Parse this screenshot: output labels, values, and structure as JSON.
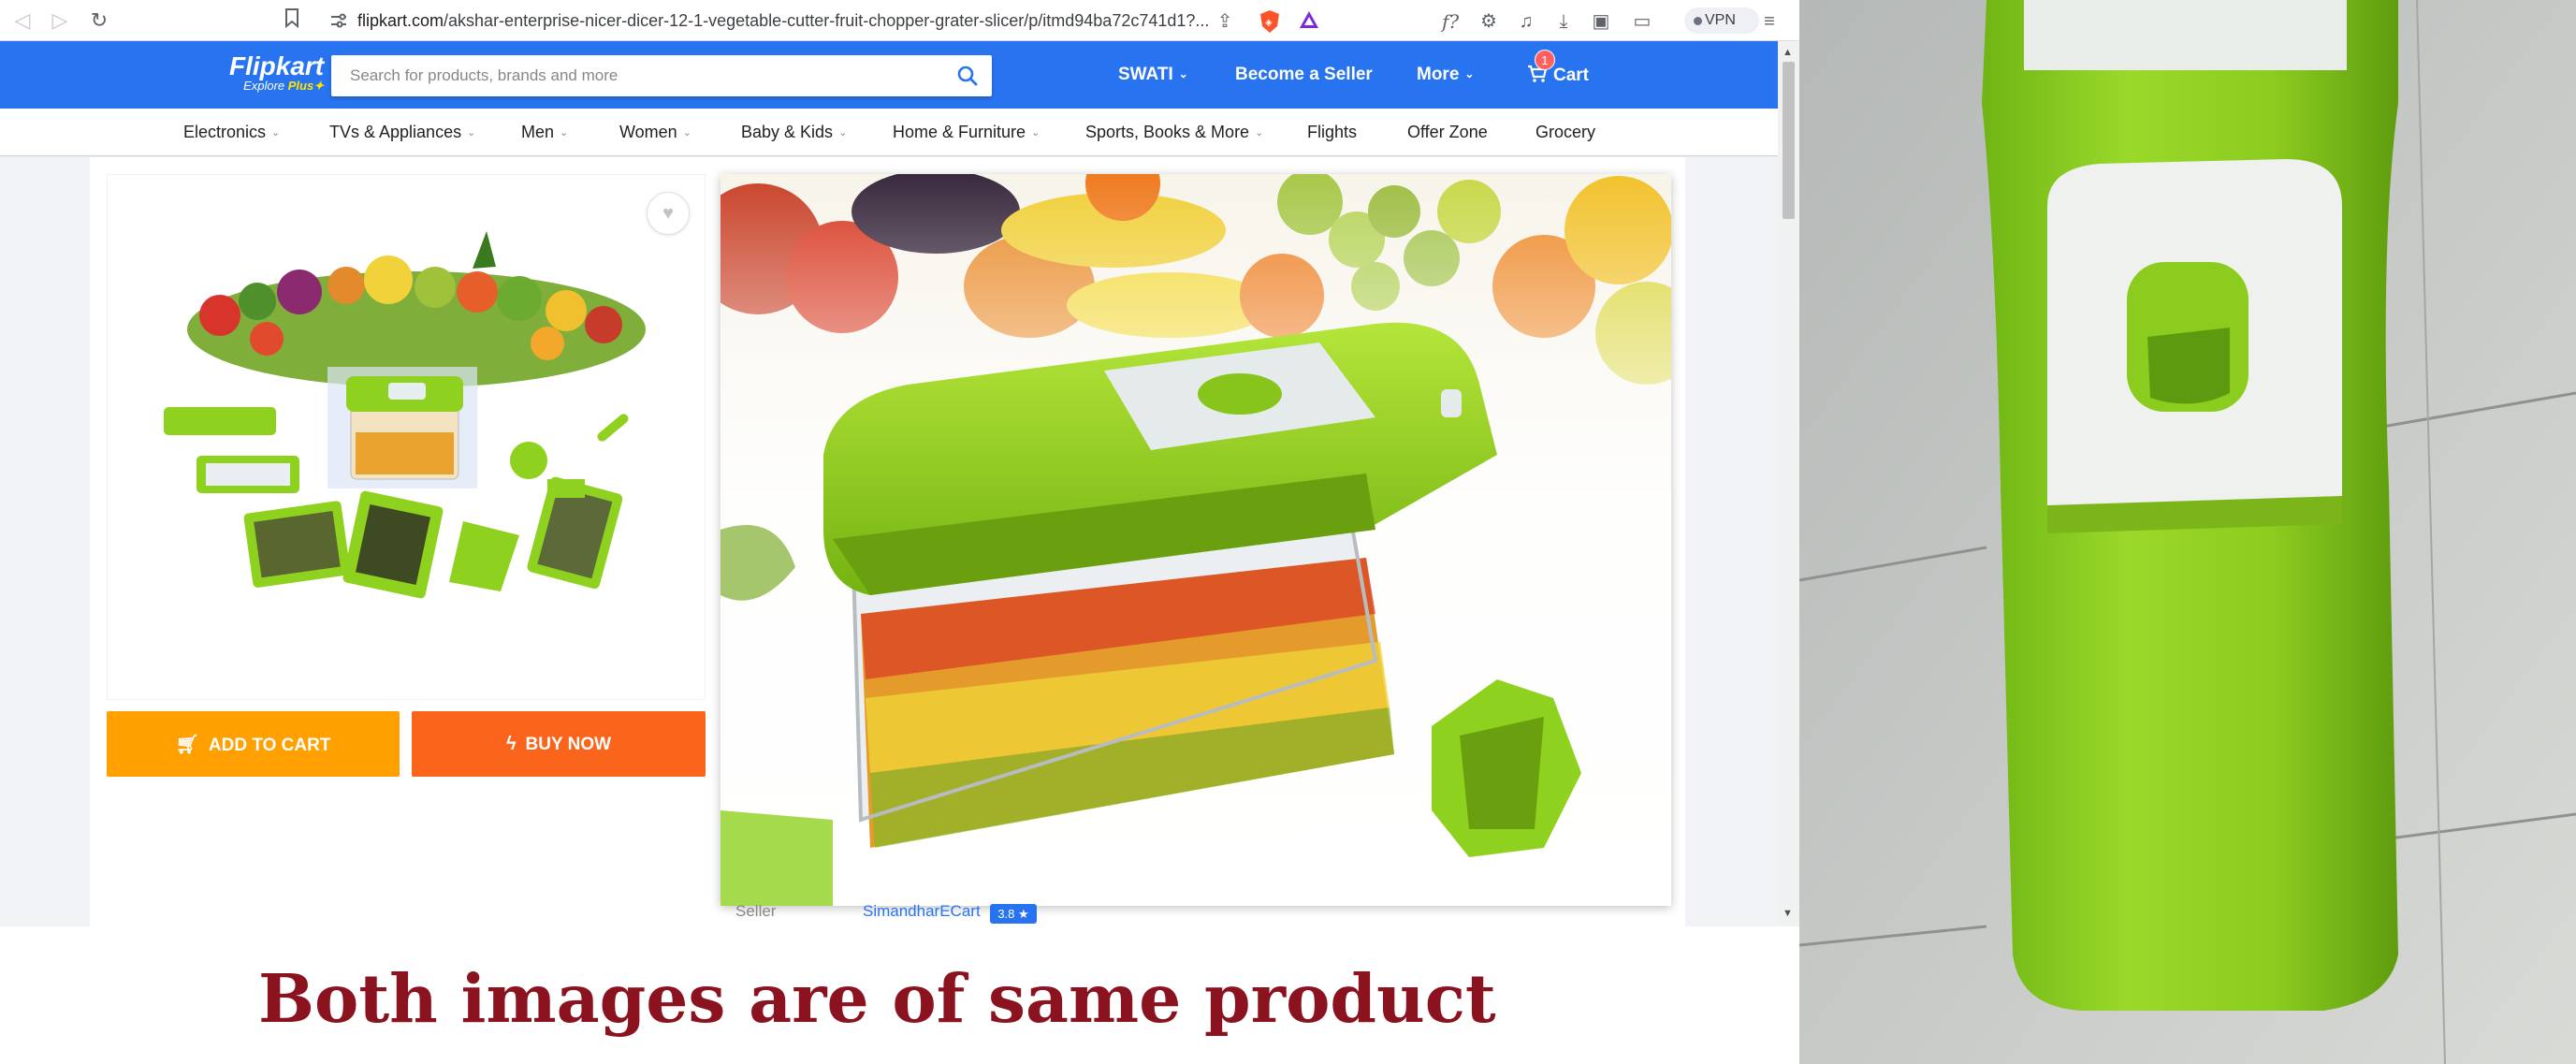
{
  "browser": {
    "url_host": "flipkart.com",
    "url_path": "/akshar-enterprise-nicer-dicer-12-1-vegetable-cutter-fruit-chopper-grater-slicer/p/itmd94ba72c741d1?...",
    "vpn_label": "VPN"
  },
  "header": {
    "logo_text": "Flipkart",
    "logo_subtitle": "Explore",
    "logo_plus": "Plus",
    "search_placeholder": "Search for products, brands and more",
    "user_label": "SWATI",
    "seller_link": "Become a Seller",
    "more_label": "More",
    "cart_label": "Cart",
    "cart_count": "1"
  },
  "categories": [
    {
      "label": "Electronics",
      "has_caret": true
    },
    {
      "label": "TVs & Appliances",
      "has_caret": true
    },
    {
      "label": "Men",
      "has_caret": true
    },
    {
      "label": "Women",
      "has_caret": true
    },
    {
      "label": "Baby & Kids",
      "has_caret": true
    },
    {
      "label": "Home & Furniture",
      "has_caret": true
    },
    {
      "label": "Sports, Books & More",
      "has_caret": true
    },
    {
      "label": "Flights",
      "has_caret": false
    },
    {
      "label": "Offer Zone",
      "has_caret": false
    },
    {
      "label": "Grocery",
      "has_caret": false
    }
  ],
  "product": {
    "add_to_cart_label": "ADD TO CART",
    "buy_now_label": "BUY NOW",
    "seller_label": "Seller",
    "seller_name": "SimandharECart",
    "seller_rating": "3.8 ★"
  },
  "caption": "Both images are of same product",
  "colors": {
    "flipkart_blue": "#2874f0",
    "add_to_cart": "#ff9f00",
    "buy_now": "#fb641b",
    "caption": "#8b1320",
    "product_green": "#8fd11f"
  }
}
